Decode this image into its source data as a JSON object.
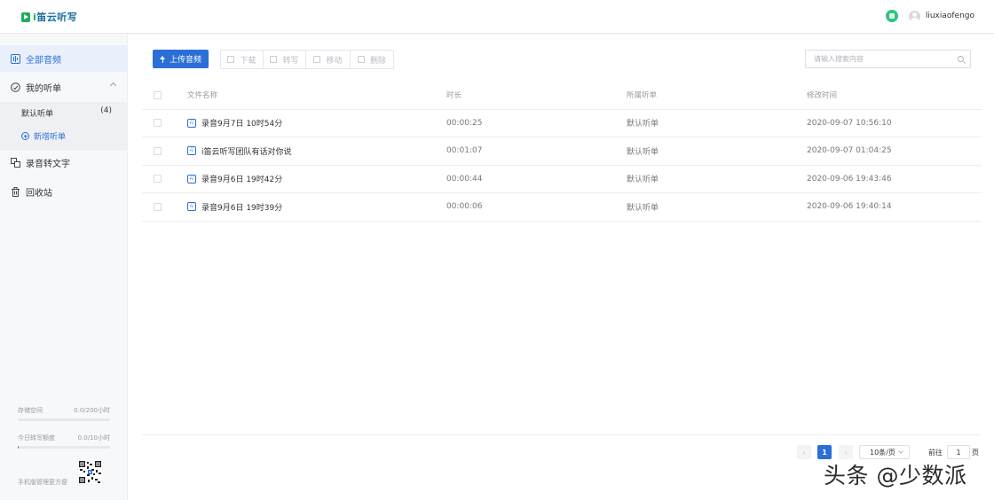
{
  "app": {
    "logo_prefix": "i",
    "logo_rest": "笛云听写"
  },
  "header": {
    "username": "liuxiaofengo"
  },
  "sidebar": {
    "nav": [
      {
        "label": "全部音频",
        "icon": "audio-library-icon",
        "active": true
      },
      {
        "label": "我的听单",
        "icon": "playlist-icon",
        "active": false
      },
      {
        "label": "录音转文字",
        "icon": "transcribe-icon",
        "active": false
      },
      {
        "label": "回收站",
        "icon": "trash-icon",
        "active": false
      }
    ],
    "playlists": [
      {
        "label": "默认听单",
        "count": "(4)"
      }
    ],
    "add_playlist": "新增听单",
    "storage": {
      "label": "存储空间",
      "value": "0.0/200小时",
      "fraction": 0.0
    },
    "daily_quota": {
      "label": "今日转写额度",
      "value": "0.0/10小时",
      "fraction": 0.01
    },
    "mobile_manage": "手机版管理更方便"
  },
  "toolbar": {
    "upload": "上传音频",
    "download": "下载",
    "transcribe": "转写",
    "move": "移动",
    "delete": "删除"
  },
  "search": {
    "placeholder": "请输入搜索内容"
  },
  "table": {
    "headers": {
      "name": "文件名称",
      "duration": "时长",
      "playlist": "所属听单",
      "modified": "修改时间"
    },
    "rows": [
      {
        "name": "录音9月7日 10时54分",
        "duration": "00:00:25",
        "playlist": "默认听单",
        "modified": "2020-09-07 10:56:10"
      },
      {
        "name": "i笛云听写团队有话对你说",
        "duration": "00:01:07",
        "playlist": "默认听单",
        "modified": "2020-09-07 01:04:25"
      },
      {
        "name": "录音9月6日 19时42分",
        "duration": "00:00:44",
        "playlist": "默认听单",
        "modified": "2020-09-06 19:43:46"
      },
      {
        "name": "录音9月6日 19时39分",
        "duration": "00:00:06",
        "playlist": "默认听单",
        "modified": "2020-09-06 19:40:14"
      }
    ]
  },
  "pagination": {
    "prev": "‹",
    "current": "1",
    "next": "›",
    "page_size": "10条/页",
    "goto_label": "前往",
    "goto_value": "1",
    "page_suffix": "页"
  },
  "watermark": "头条 @少数派",
  "colors": {
    "primary": "#2b6fd6",
    "brand_green": "#1aae5a",
    "status_green": "#33c37a"
  }
}
